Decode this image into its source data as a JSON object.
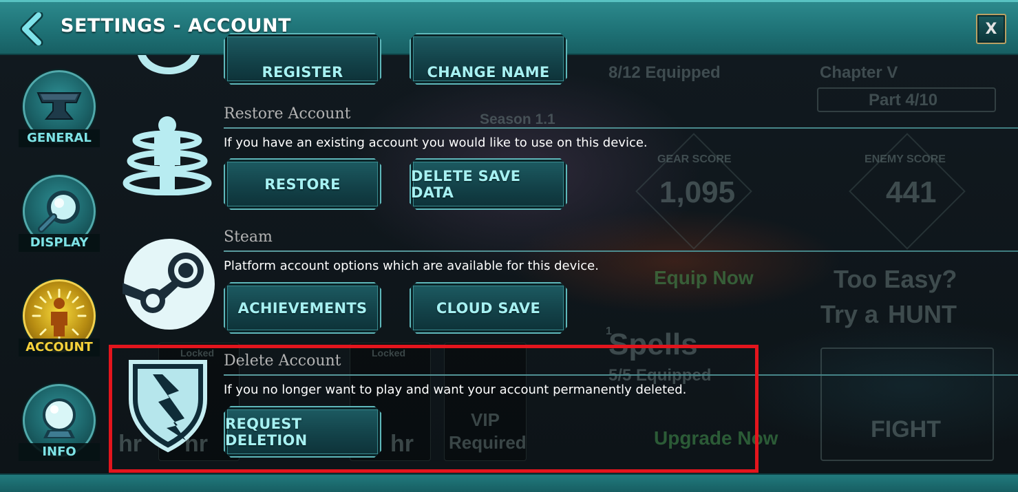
{
  "header": {
    "title": "SETTINGS - ACCOUNT",
    "close_label": "X"
  },
  "nav": {
    "items": [
      {
        "label": "GENERAL",
        "icon": "anvil-icon",
        "active": false
      },
      {
        "label": "DISPLAY",
        "icon": "magnifier-icon",
        "active": false
      },
      {
        "label": "ACCOUNT",
        "icon": "account-person-icon",
        "active": true
      },
      {
        "label": "INFO",
        "icon": "crystal-ball-icon",
        "active": false
      }
    ]
  },
  "sections": {
    "top": {
      "buttons": [
        "REGISTER",
        "CHANGE NAME"
      ]
    },
    "restore": {
      "title": "Restore Account",
      "description": "If you have an existing account you would like to use on this device.",
      "buttons": [
        "RESTORE",
        "DELETE SAVE DATA"
      ],
      "icon": "restore-person-icon"
    },
    "steam": {
      "title": "Steam",
      "description": "Platform account options which are available for this device.",
      "buttons": [
        "ACHIEVEMENTS",
        "CLOUD SAVE"
      ],
      "icon": "steam-logo-icon"
    },
    "delete": {
      "title": "Delete Account",
      "description": "If you no longer want to play and want your account permanently deleted.",
      "buttons": [
        "REQUEST DELETION"
      ],
      "icon": "broken-shield-icon"
    }
  },
  "background": {
    "equipped_top": "8/12 Equipped",
    "chapter": "Chapter V",
    "part": "Part 4/10",
    "season": "Season 1.1",
    "gear_score_label": "GEAR SCORE",
    "gear_score": "1,095",
    "enemy_score_label": "ENEMY SCORE",
    "enemy_score": "441",
    "equip_now": "Equip Now",
    "too_easy": "Too Easy?",
    "try_a": "Try a",
    "hunt": "HUNT",
    "spells": "Spells",
    "spells_equipped": "5/5 Equipped",
    "locked_a": "Locked",
    "locked_b": "Locked",
    "vip": "VIP",
    "required": "Required",
    "upgrade_now": "Upgrade Now",
    "fight": "FIGHT",
    "hr_a": "hr",
    "hr_b": "hr",
    "hr_c": "hr",
    "badge_count": "1"
  },
  "colors": {
    "title_bar": "#1f7377",
    "button_text": "#a6f1f2",
    "nav_active": "#f6d23a",
    "highlight": "#e3151d"
  }
}
